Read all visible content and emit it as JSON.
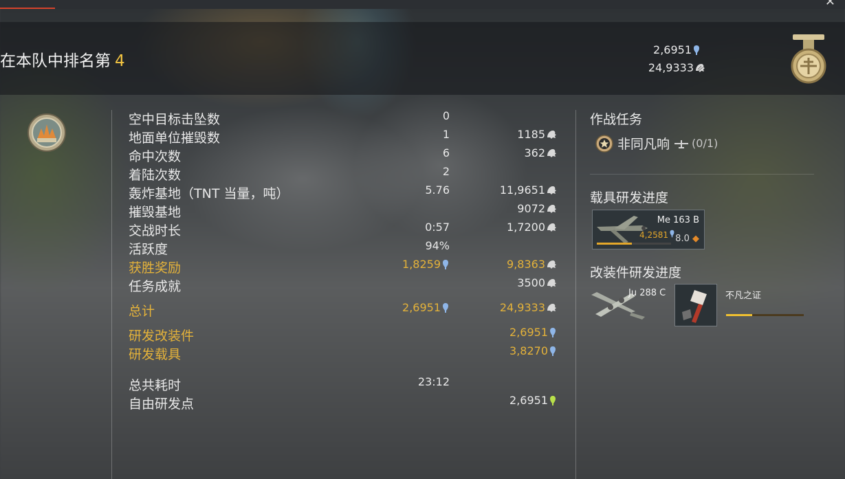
{
  "header": {
    "rank_prefix": "在本队中排名第",
    "rank_value": "4",
    "total_sl": "2,6951",
    "total_xp": "24,9333"
  },
  "colors": {
    "gold": "#e4b23a",
    "sl_icon": "#8fb6e8",
    "xp_icon": "#d9d9d9",
    "free_rp_icon": "#b8e04a"
  },
  "stats": [
    {
      "label": "空中目标击坠数",
      "count": "0",
      "reward": "",
      "reward_icon": ""
    },
    {
      "label": "地面单位摧毁数",
      "count": "1",
      "reward": "1185",
      "reward_icon": "xp-icon"
    },
    {
      "label": "命中次数",
      "count": "6",
      "reward": "362",
      "reward_icon": "xp-icon"
    },
    {
      "label": "着陆次数",
      "count": "2",
      "reward": "",
      "reward_icon": ""
    },
    {
      "label": "轰炸基地（TNT 当量，吨）",
      "count": "5.76",
      "reward": "11,9651",
      "reward_icon": "xp-icon"
    },
    {
      "label": "摧毁基地",
      "count": "",
      "reward": "9072",
      "reward_icon": "xp-icon"
    },
    {
      "label": "交战时长",
      "count": "0:57",
      "reward": "1,7200",
      "reward_icon": "xp-icon"
    },
    {
      "label": "活跃度",
      "count": "94%",
      "reward": "",
      "reward_icon": ""
    },
    {
      "label": "获胜奖励",
      "count": "1,8259",
      "reward": "9,8363",
      "reward_icon": "xp-icon"
    },
    {
      "label": "任务成就",
      "count": "",
      "reward": "3500",
      "reward_icon": "xp-icon"
    }
  ],
  "totals": {
    "label": "总计",
    "sl": "2,6951",
    "xp": "24,9333"
  },
  "research": [
    {
      "label": "研发改装件",
      "value": "2,6951"
    },
    {
      "label": "研发载具",
      "value": "3,8270"
    }
  ],
  "time": {
    "label": "总共耗时",
    "value": "23:12"
  },
  "free_rp": {
    "label": "自由研发点",
    "value": "2,6951"
  },
  "missions": {
    "title": "作战任务",
    "task_name": "非同凡响",
    "task_progress": "(0/1)"
  },
  "vehicle_progress": {
    "title": "载具研发进度",
    "vehicle_name": "Me 163 B",
    "rp": "4,2581",
    "br": "8.0",
    "progress": 0.47
  },
  "mod_progress": {
    "title": "改装件研发进度",
    "vehicle_name": "Ju 288 C",
    "mod_name": "不凡之证",
    "progress": 0.34
  },
  "top_tabs": [
    "",
    "",
    "",
    "",
    "",
    ""
  ]
}
